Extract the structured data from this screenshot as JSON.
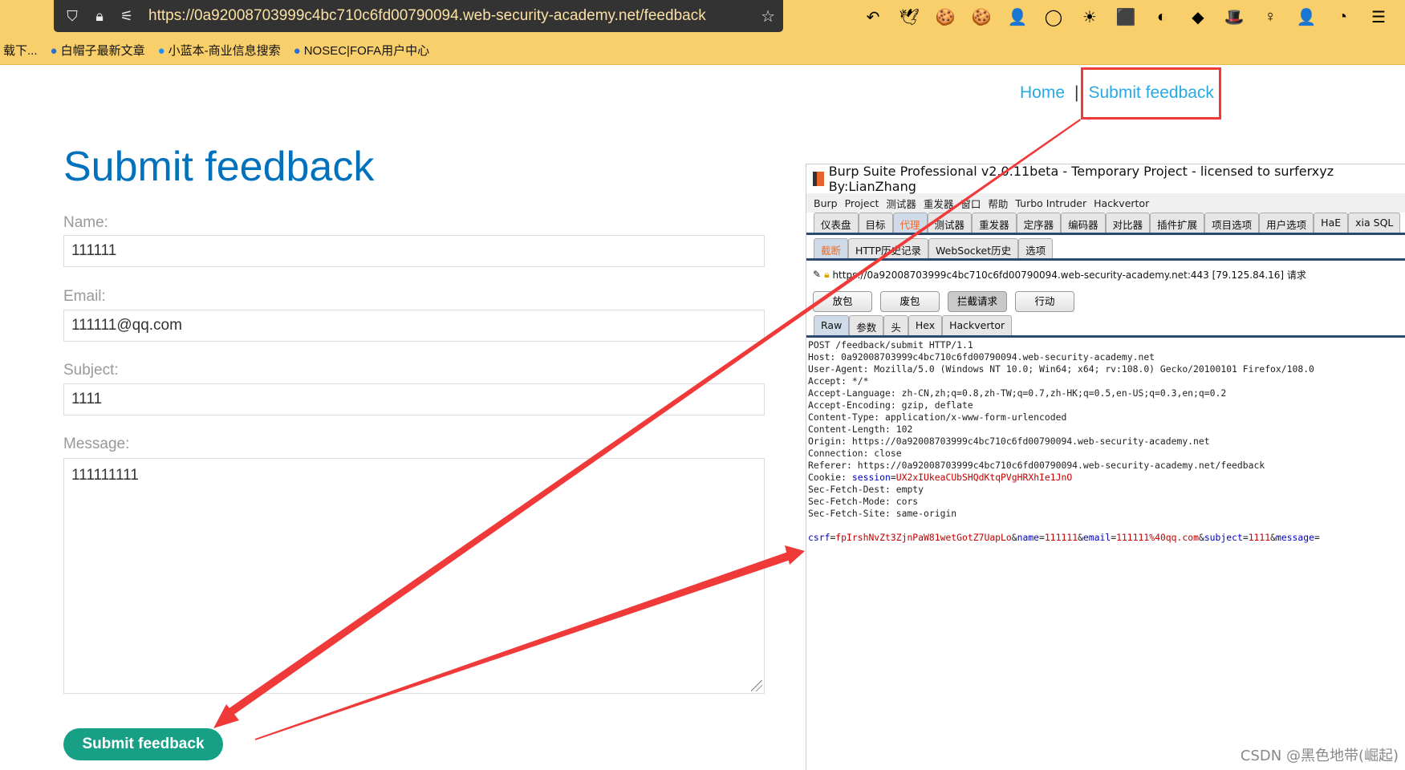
{
  "browser": {
    "url": "https://0a92008703999c4bc710c6fd00790094.web-security-academy.net/feedback",
    "bookmarks": [
      {
        "label": "载下..."
      },
      {
        "label": "白帽子最新文章"
      },
      {
        "label": "小蓝本-商业信息搜索"
      },
      {
        "label": "NOSEC|FOFA用户中心"
      }
    ],
    "extensions": [
      "↶",
      "🕊",
      "🍪",
      "🍪",
      "👤",
      "◯",
      "☀",
      "⬛",
      "◐",
      "◆",
      "🎩",
      "♀",
      "👤",
      "◔",
      "☰"
    ]
  },
  "page": {
    "nav": {
      "home": "Home",
      "sep": "|",
      "feedback": "Submit feedback"
    },
    "title": "Submit feedback",
    "form": {
      "name_label": "Name:",
      "name": "111111",
      "email_label": "Email:",
      "email": "111111@qq.com",
      "subject_label": "Subject:",
      "subject": "1111",
      "message_label": "Message:",
      "message": "111111111",
      "submit": "Submit feedback"
    }
  },
  "burp": {
    "title": "Burp Suite Professional v2.0.11beta - Temporary Project - licensed to surferxyz By:LianZhang",
    "menu": [
      "Burp",
      "Project",
      "测试器",
      "重发器",
      "窗口",
      "帮助",
      "Turbo Intruder",
      "Hackvertor"
    ],
    "tabs": [
      "仪表盘",
      "目标",
      "代理",
      "测试器",
      "重发器",
      "定序器",
      "编码器",
      "对比器",
      "插件扩展",
      "项目选项",
      "用户选项",
      "HaE",
      "xia SQL"
    ],
    "subtabs": [
      "截断",
      "HTTP历史记录",
      "WebSocket历史",
      "选项"
    ],
    "request_target": "https://0a92008703999c4bc710c6fd00790094.web-security-academy.net:443  [79.125.84.16] 请求",
    "actions": [
      "放包",
      "废包",
      "拦截请求",
      "行动"
    ],
    "viewtabs": [
      "Raw",
      "参数",
      "头",
      "Hex",
      "Hackvertor"
    ],
    "headers": [
      "POST /feedback/submit HTTP/1.1",
      "Host: 0a92008703999c4bc710c6fd00790094.web-security-academy.net",
      "User-Agent: Mozilla/5.0 (Windows NT 10.0; Win64; x64; rv:108.0) Gecko/20100101 Firefox/108.0",
      "Accept: */*",
      "Accept-Language: zh-CN,zh;q=0.8,zh-TW;q=0.7,zh-HK;q=0.5,en-US;q=0.3,en;q=0.2",
      "Accept-Encoding: gzip, deflate",
      "Content-Type: application/x-www-form-urlencoded",
      "Content-Length: 102",
      "Origin: https://0a92008703999c4bc710c6fd00790094.web-security-academy.net",
      "Connection: close",
      "Referer: https://0a92008703999c4bc710c6fd00790094.web-security-academy.net/feedback"
    ],
    "cookie": {
      "prefix": "Cookie: ",
      "key": "session",
      "eq": "=",
      "value": "UX2xIUkeaCUbSHQdKtqPVgHRXhIe1JnO"
    },
    "headers2": [
      "Sec-Fetch-Dest: empty",
      "Sec-Fetch-Mode: cors",
      "Sec-Fetch-Site: same-origin"
    ],
    "params": [
      {
        "k": "csrf",
        "v": "fpIrshNvZt3ZjnPaW81wetGotZ7UapLo"
      },
      {
        "k": "name",
        "v": "111111"
      },
      {
        "k": "email",
        "v": "111111%40qq.com"
      },
      {
        "k": "subject",
        "v": "1111"
      },
      {
        "k": "message",
        "v": ""
      }
    ]
  },
  "watermark": "CSDN @黑色地带(崛起)",
  "colors": {
    "accent": "#0071bc",
    "button": "#17a086",
    "arrow": "#f03a3a"
  }
}
